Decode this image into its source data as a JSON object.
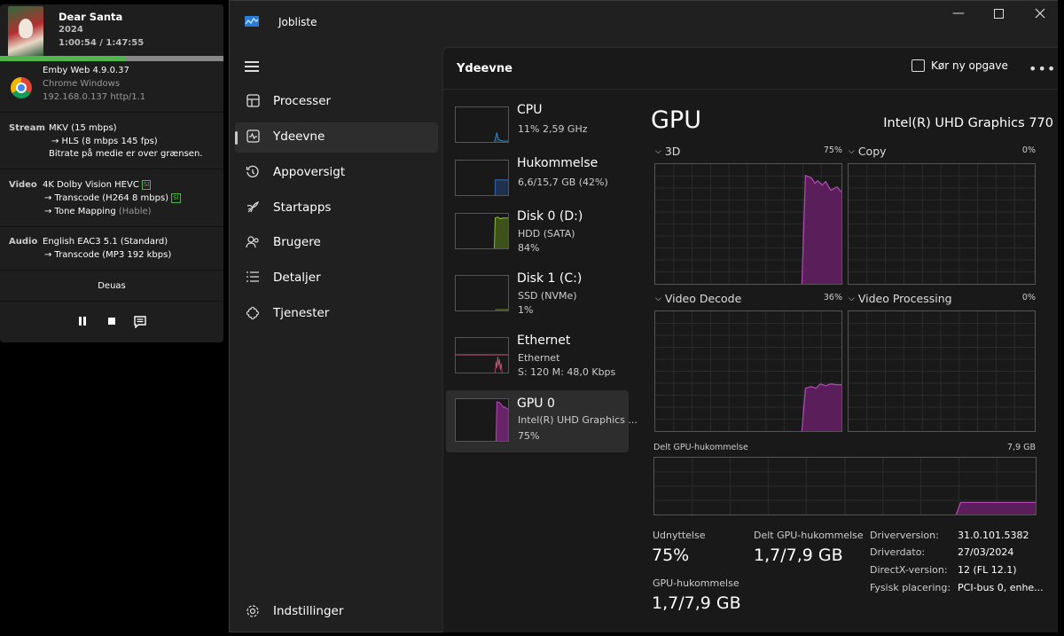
{
  "emby": {
    "title": "Dear Santa",
    "year": "2024",
    "time": "1:00:54 / 1:47:55",
    "progress": 0.56,
    "client": "Emby Web 4.9.0.37",
    "browser": "Chrome Windows",
    "address": "192.168.0.137 http/1.1",
    "stream": {
      "label": "Stream",
      "line1": "MKV (15 mbps)",
      "line2": "→  HLS (8 mbps 145 fps)",
      "line3": "Bitrate på medie er over grænsen."
    },
    "video": {
      "label": "Video",
      "line1": "4K Dolby Vision HEVC",
      "badge": "SI",
      "line2": "→  Transcode (H264 8 mbps)",
      "badge2": "SI",
      "line3": "→  Tone Mapping",
      "line3b": "(Hable)"
    },
    "audio": {
      "label": "Audio",
      "line1": "English EAC3 5.1 (Standard)",
      "line2": "→  Transcode (MP3 192 kbps)"
    },
    "device": "Deuas",
    "pause_icon": "pause-icon",
    "stop_icon": "stop-icon",
    "subtitle_icon": "subtitle-icon"
  },
  "tm": {
    "title": "Jobliste",
    "nav": [
      {
        "label": "Processer",
        "icon": "processes-icon"
      },
      {
        "label": "Ydeevne",
        "icon": "performance-icon"
      },
      {
        "label": "Appoversigt",
        "icon": "app-history-icon"
      },
      {
        "label": "Startapps",
        "icon": "startup-icon"
      },
      {
        "label": "Brugere",
        "icon": "users-icon"
      },
      {
        "label": "Detaljer",
        "icon": "details-icon"
      },
      {
        "label": "Tjenester",
        "icon": "services-icon"
      }
    ],
    "settings": "Indstillinger",
    "page_title": "Ydeevne",
    "run_task": "Kør ny opgave",
    "more": "•••",
    "devices": [
      {
        "name": "CPU",
        "sub1": "11%  2,59 GHz",
        "sub2": ""
      },
      {
        "name": "Hukommelse",
        "sub1": "6,6/15,7 GB (42%)",
        "sub2": ""
      },
      {
        "name": "Disk 0 (D:)",
        "sub1": "HDD (SATA)",
        "sub2": "84%"
      },
      {
        "name": "Disk 1 (C:)",
        "sub1": "SSD (NVMe)",
        "sub2": "1%"
      },
      {
        "name": "Ethernet",
        "sub1": "Ethernet",
        "sub2": "S: 120  M: 48,0 Kbps"
      },
      {
        "name": "GPU 0",
        "sub1": "Intel(R) UHD Graphics ...",
        "sub2": "75%"
      }
    ],
    "gpu": {
      "heading": "GPU",
      "model": "Intel(R) UHD Graphics 770",
      "graphs": [
        {
          "label": "3D",
          "pct": "75%"
        },
        {
          "label": "Copy",
          "pct": "0%"
        },
        {
          "label": "Video Decode",
          "pct": "36%"
        },
        {
          "label": "Video Processing",
          "pct": "0%"
        }
      ],
      "shared_label": "Delt GPU-hukommelse",
      "shared_max": "7,9 GB",
      "util_label": "Udnyttelse",
      "util_value": "75%",
      "shared_mem_label": "Delt GPU-hukommelse",
      "shared_mem_value": "1,7/7,9 GB",
      "gpu_mem_label": "GPU-hukommelse",
      "gpu_mem_value": "1,7/7,9 GB",
      "driver": [
        {
          "k": "Driverversion:",
          "v": "31.0.101.5382"
        },
        {
          "k": "Driverdato:",
          "v": "27/03/2024"
        },
        {
          "k": "DirectX-version:",
          "v": "12 (FL 12.1)"
        },
        {
          "k": "Fysisk placering:",
          "v": "PCI-bus 0, enhe..."
        }
      ]
    },
    "colors": {
      "gpu": "#8b2a8b",
      "cpu": "#2a8fd6",
      "memory": "#2a5fb0",
      "disk": "#6b9a1e",
      "ethernet": "#c75a7a"
    }
  }
}
